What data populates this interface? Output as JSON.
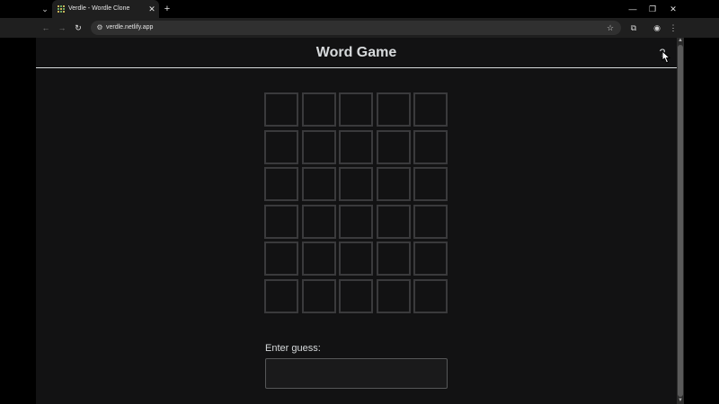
{
  "browser": {
    "tab": {
      "title": "Verdle - Wordle Clone",
      "close_icon": "✕"
    },
    "new_tab_icon": "+",
    "tab_dropdown_icon": "⌄",
    "window": {
      "minimize_icon": "—",
      "restore_icon": "❐",
      "close_icon": "✕"
    },
    "nav": {
      "back_icon": "←",
      "forward_icon": "→",
      "reload_icon": "↻"
    },
    "address_bar": {
      "url": "verdle.netlify.app",
      "site_info_icon": "⚙",
      "star_icon": "☆"
    },
    "extensions_icon": "⧉",
    "profile_icon": "◉",
    "menu_icon": "⋮"
  },
  "page": {
    "title": "Word Game",
    "help_icon": "?",
    "board": {
      "rows": 6,
      "cols": 5
    },
    "guess": {
      "label": "Enter guess:",
      "value": "",
      "placeholder": ""
    }
  },
  "scrollbar": {
    "up_icon": "▲",
    "down_icon": "▼"
  }
}
